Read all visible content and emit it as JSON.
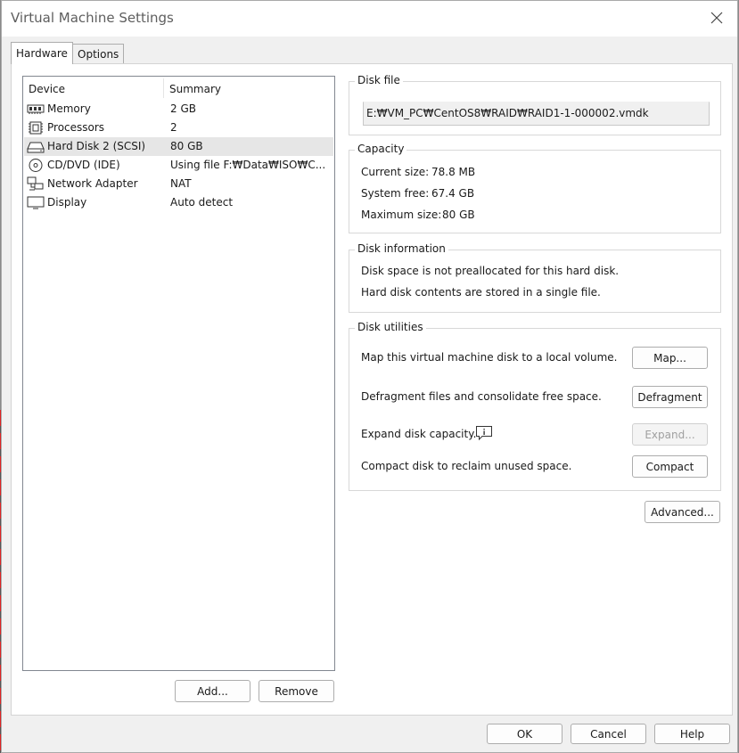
{
  "window": {
    "title": "Virtual Machine Settings"
  },
  "tabs": [
    {
      "label": "Hardware"
    },
    {
      "label": "Options"
    }
  ],
  "device_list": {
    "headers": {
      "device": "Device",
      "summary": "Summary"
    },
    "rows": [
      {
        "icon": "memory-icon",
        "device": "Memory",
        "summary": "2 GB"
      },
      {
        "icon": "processor-icon",
        "device": "Processors",
        "summary": "2"
      },
      {
        "icon": "hard-disk-icon",
        "device": "Hard Disk 2 (SCSI)",
        "summary": "80 GB"
      },
      {
        "icon": "cd-dvd-icon",
        "device": "CD/DVD (IDE)",
        "summary": "Using file F:₩Data₩ISO₩C..."
      },
      {
        "icon": "network-adapter-icon",
        "device": "Network Adapter",
        "summary": "NAT"
      },
      {
        "icon": "display-icon",
        "device": "Display",
        "summary": "Auto detect"
      }
    ],
    "selected_index": 2
  },
  "list_buttons": {
    "add": "Add...",
    "remove": "Remove"
  },
  "disk_file": {
    "label": "Disk file",
    "path": "E:₩VM_PC₩CentOS8₩RAID₩RAID1-1-000002.vmdk"
  },
  "capacity": {
    "label": "Capacity",
    "current_label": "Current size:",
    "current_value": "78.8 MB",
    "free_label": "System free:",
    "free_value": "67.4 GB",
    "max_label": "Maximum size:",
    "max_value": "80 GB"
  },
  "disk_info": {
    "label": "Disk information",
    "line1": "Disk space is not preallocated for this hard disk.",
    "line2": "Hard disk contents are stored in a single file."
  },
  "disk_utilities": {
    "label": "Disk utilities",
    "map_text": "Map this virtual machine disk to a local volume.",
    "map_button": "Map...",
    "defrag_text": "Defragment files and consolidate free space.",
    "defrag_button": "Defragment",
    "expand_text": "Expand disk capacity.",
    "expand_button": "Expand...",
    "compact_text": "Compact disk to reclaim unused space.",
    "compact_button": "Compact"
  },
  "advanced_button": "Advanced...",
  "footer": {
    "ok": "OK",
    "cancel": "Cancel",
    "help": "Help"
  }
}
